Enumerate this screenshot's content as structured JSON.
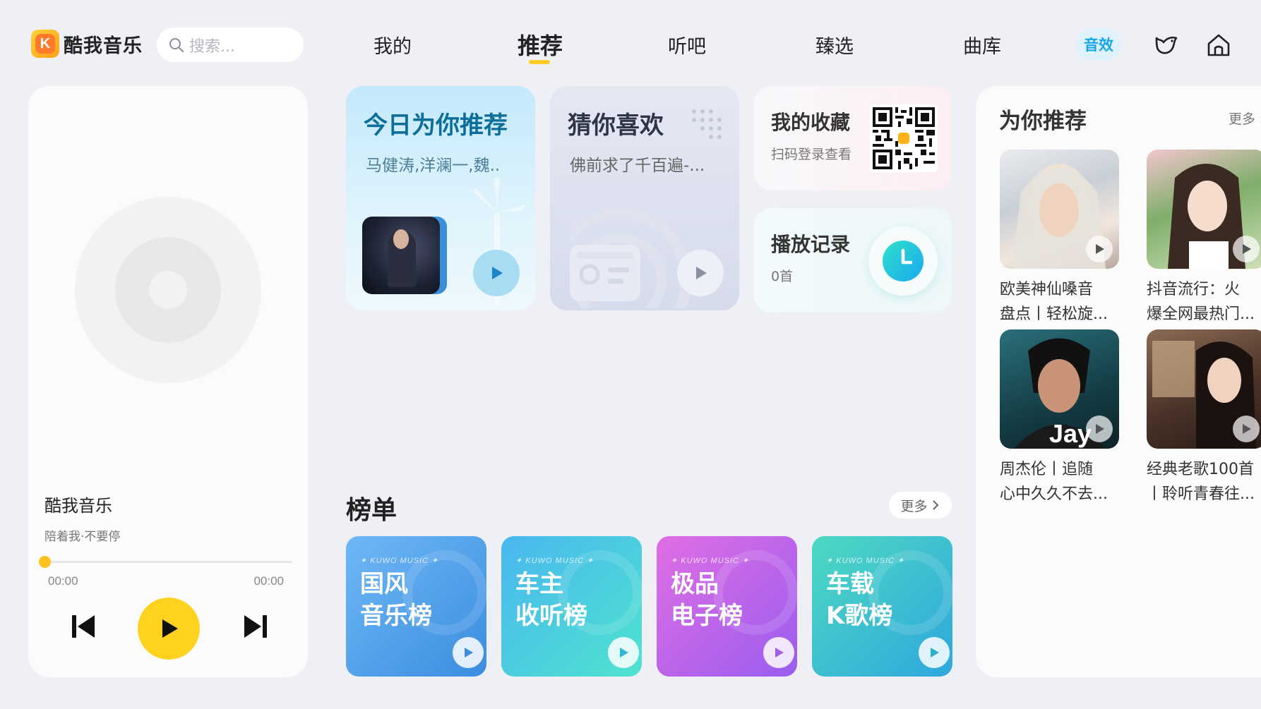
{
  "app": {
    "name": "酷我音乐",
    "accent": "#ffd21f"
  },
  "search": {
    "placeholder": "搜索..."
  },
  "nav": {
    "tabs": [
      {
        "label": "我的",
        "active": false
      },
      {
        "label": "推荐",
        "active": true
      },
      {
        "label": "听吧",
        "active": false
      },
      {
        "label": "臻选",
        "active": false
      },
      {
        "label": "曲库",
        "active": false
      }
    ],
    "sound_effect_label": "音效",
    "icons": [
      "bird-icon",
      "home-icon"
    ]
  },
  "player": {
    "title": "酷我音乐",
    "subtitle": "陪着我·不要停",
    "time_current": "00:00",
    "time_total": "00:00",
    "progress": 0
  },
  "features": {
    "today": {
      "title": "今日为你推荐",
      "subtitle": "马健涛,洋澜一,魏.."
    },
    "guess": {
      "title": "猜你喜欢",
      "subtitle": "佛前求了千百遍-..."
    },
    "favorites": {
      "title": "我的收藏",
      "subtitle": "扫码登录查看"
    },
    "history": {
      "title": "播放记录",
      "subtitle": "0首"
    }
  },
  "rankings": {
    "title": "榜单",
    "more_label": "更多",
    "brand": "✦ KUWO MUSIC ✦",
    "items": [
      {
        "line1": "国风",
        "line2": "音乐榜",
        "color": "#4a9fe6"
      },
      {
        "line1": "车主",
        "line2": "收听榜",
        "color": "#3fcfd6"
      },
      {
        "line1": "极品",
        "line2": "电子榜",
        "color": "#b565e8"
      },
      {
        "line1": "车载",
        "line2": "K歌榜",
        "color": "#3ccfbf"
      }
    ]
  },
  "recommend": {
    "title": "为你推荐",
    "more_label": "更多 ›",
    "items": [
      {
        "line1": "欧美神仙嗓音",
        "line2": "盘点丨轻松旋..."
      },
      {
        "line1": "抖音流行：火",
        "line2": "爆全网最热门..."
      },
      {
        "line1": "周杰伦丨追随",
        "line2": "心中久久不去..."
      },
      {
        "line1": "经典老歌100首",
        "line2": "丨聆听青春往..."
      }
    ]
  }
}
